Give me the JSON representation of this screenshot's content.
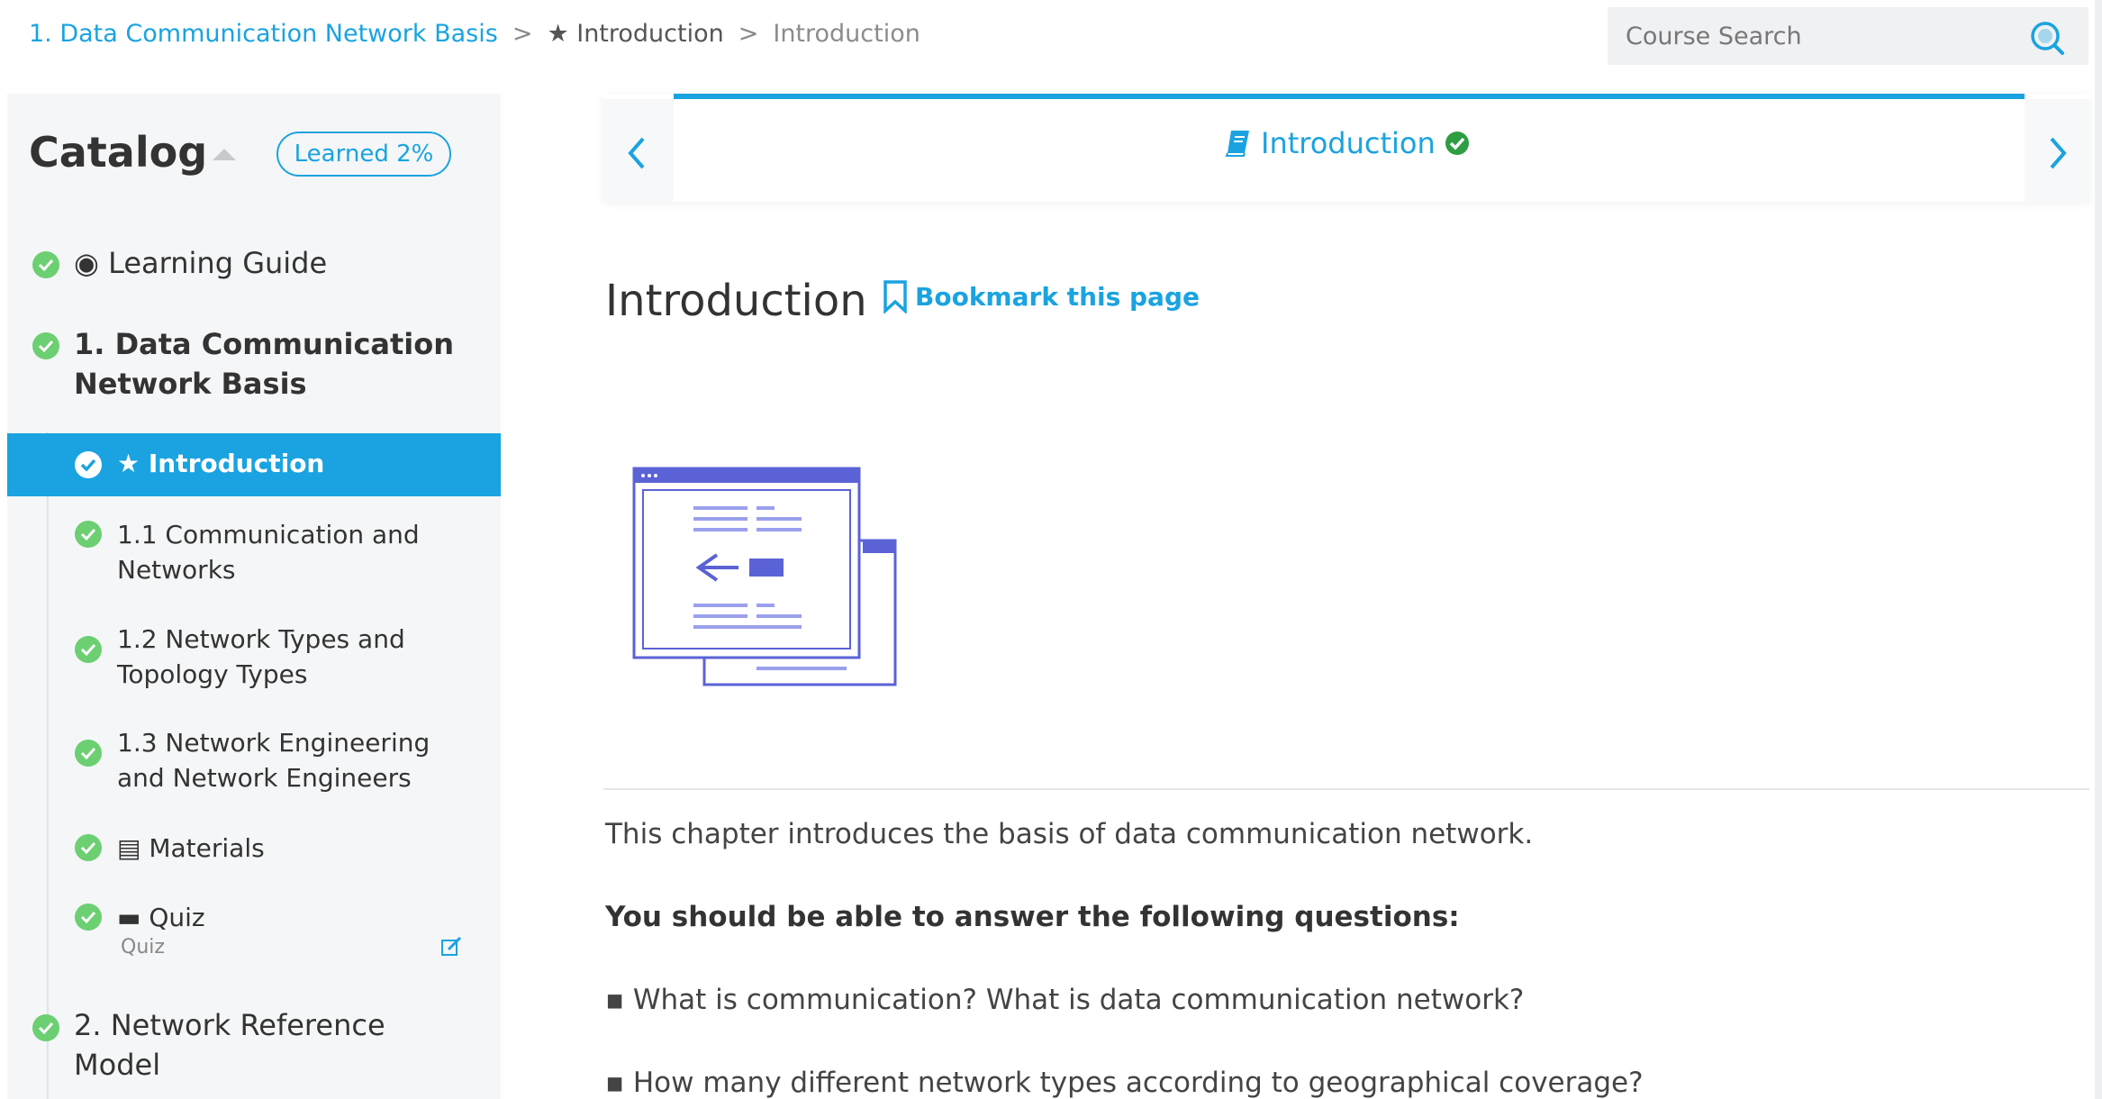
{
  "breadcrumb": {
    "link": "1. Data Communication Network Basis",
    "sep1": ">",
    "middle": "★ Introduction",
    "sep2": ">",
    "current": "Introduction"
  },
  "search": {
    "placeholder": "Course Search"
  },
  "sidebar": {
    "title": "Catalog",
    "learned_badge": "Learned 2%",
    "items": [
      {
        "label": "◉ Learning Guide",
        "completed": true
      },
      {
        "label_line1": "1. Data Communication",
        "label_line2": "Network Basis",
        "completed": true
      },
      {
        "label": "★ Introduction",
        "completed": true,
        "active": true
      },
      {
        "label_line1": "1.1 Communication and",
        "label_line2": "Networks",
        "completed": true
      },
      {
        "label_line1": "1.2 Network Types and",
        "label_line2": "Topology Types",
        "completed": true
      },
      {
        "label_line1": "1.3 Network Engineering",
        "label_line2": "and Network Engineers",
        "completed": true
      },
      {
        "label": "▤ Materials",
        "completed": true
      },
      {
        "label": "▬ Quiz",
        "sublabel": "Quiz",
        "completed": true
      },
      {
        "label_line1": "2. Network Reference",
        "label_line2": "Model",
        "completed": true
      }
    ]
  },
  "lesson_nav": {
    "title": "Introduction",
    "progress": 1.0,
    "book_icon": "book-icon",
    "status_icon": "check-circle-icon"
  },
  "content": {
    "title": "Introduction",
    "bookmark_label": "Bookmark this page",
    "intro": "This chapter introduces the basis of data communication network.",
    "questions_heading": "You should be able to answer the following questions:",
    "question1": "▪ What is communication? What is data communication network?",
    "question2": "▪ How many different network types according to geographical coverage?"
  },
  "colors": {
    "accent": "#1aa3e0",
    "success": "#6ccf72",
    "sidebar_bg": "#f5f6f7",
    "illustration": "#5b62d6"
  }
}
